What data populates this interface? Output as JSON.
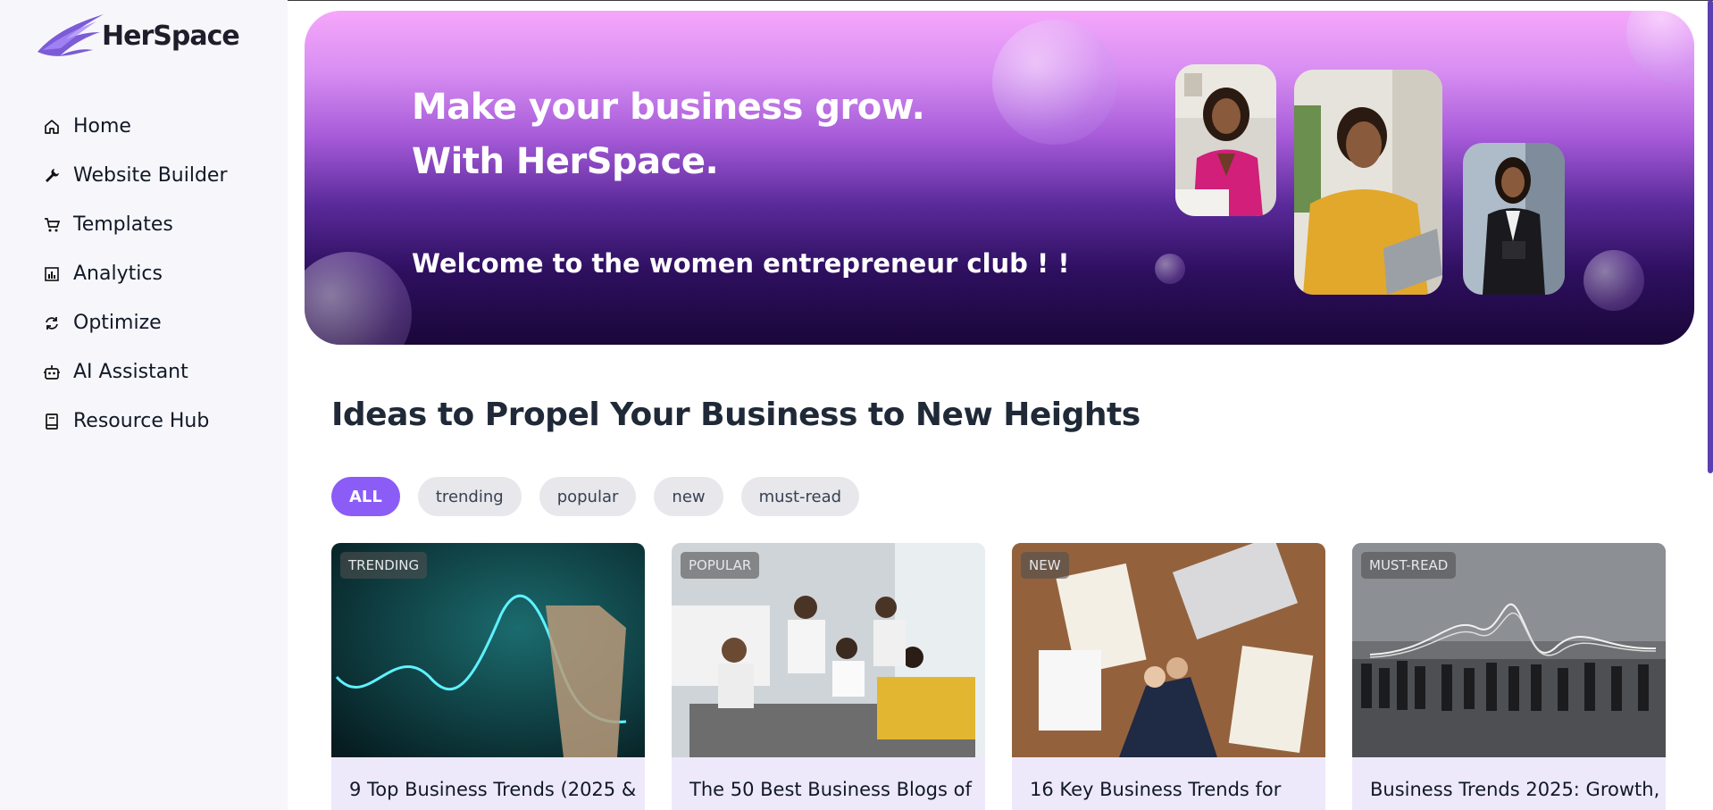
{
  "brand": {
    "name": "HerSpace"
  },
  "sidebar": {
    "items": [
      {
        "label": "Home",
        "icon": "home-icon"
      },
      {
        "label": "Website Builder",
        "icon": "wrench-icon"
      },
      {
        "label": "Templates",
        "icon": "cart-icon"
      },
      {
        "label": "Analytics",
        "icon": "bar-chart-icon"
      },
      {
        "label": "Optimize",
        "icon": "refresh-icon"
      },
      {
        "label": "AI Assistant",
        "icon": "robot-icon"
      },
      {
        "label": "Resource Hub",
        "icon": "book-icon"
      }
    ]
  },
  "hero": {
    "title_line1": "Make your business grow.",
    "title_line2": "With HerSpace.",
    "subtitle": "Welcome to the women entrepreneur club ! !"
  },
  "section": {
    "title": "Ideas to Propel Your Business to New Heights"
  },
  "filters": [
    {
      "label": "ALL",
      "active": true
    },
    {
      "label": "trending",
      "active": false
    },
    {
      "label": "popular",
      "active": false
    },
    {
      "label": "new",
      "active": false
    },
    {
      "label": "must-read",
      "active": false
    }
  ],
  "cards": [
    {
      "badge": "TRENDING",
      "title": "9 Top Business Trends (2025 &"
    },
    {
      "badge": "POPULAR",
      "title": "The 50 Best Business Blogs of"
    },
    {
      "badge": "NEW",
      "title": "16 Key Business Trends for"
    },
    {
      "badge": "MUST-READ",
      "title": "Business Trends 2025: Growth,"
    }
  ],
  "colors": {
    "accent": "#8b5cf6",
    "sidebar_bg": "#f7f7fb",
    "card_bg": "#ede9fb"
  }
}
